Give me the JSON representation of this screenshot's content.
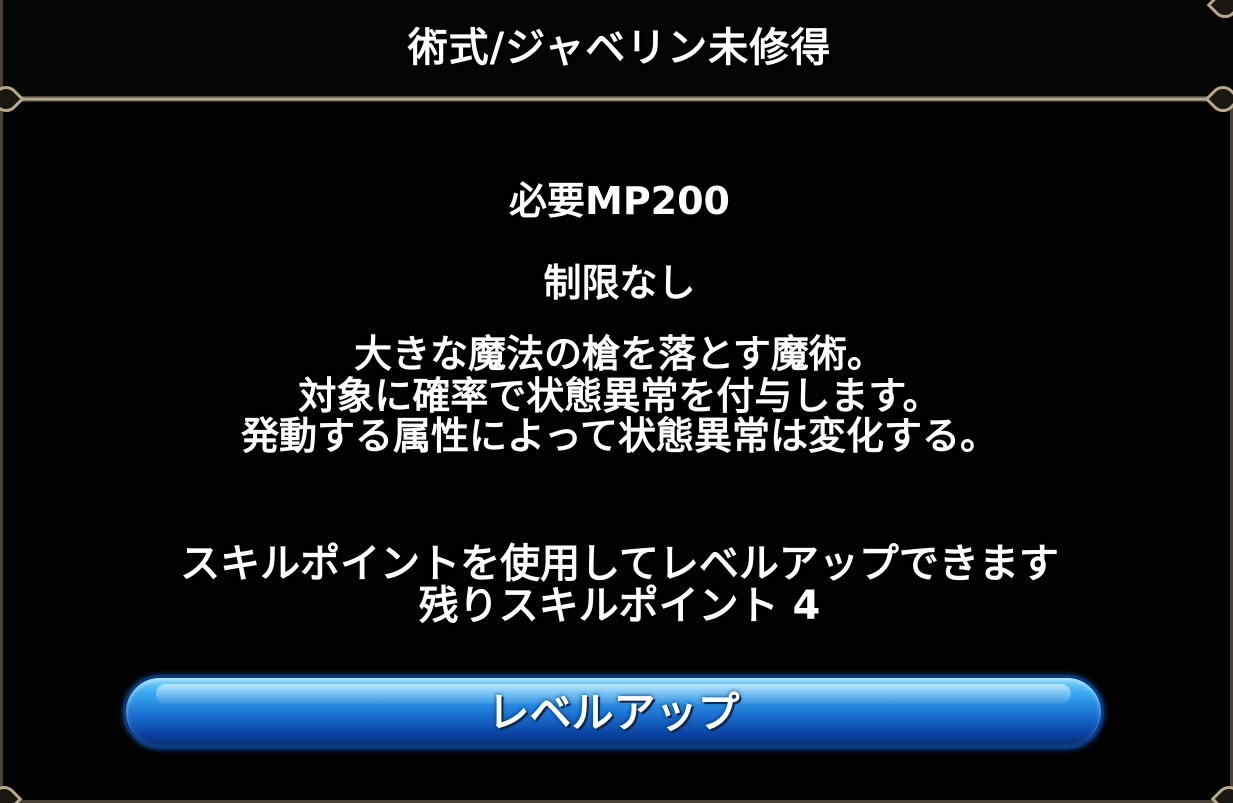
{
  "dialog": {
    "title": "術式/ジャベリン未修得",
    "required_mp": "必要MP200",
    "restriction": "制限なし",
    "description": [
      "大きな魔法の槍を落とす魔術。",
      "対象に確率で状態異常を付与します。",
      "発動する属性によって状態異常は変化する。"
    ],
    "skill_point_notice": "スキルポイントを使用してレベルアップできます",
    "remaining_skill_points": "残りスキルポイント 4",
    "levelup_button_label": "レベルアップ"
  },
  "colors": {
    "background": "#000000",
    "text": "#ffffff",
    "frame": "#b8a98c",
    "button_top": "#7fd8ff",
    "button_bottom": "#07306f"
  }
}
